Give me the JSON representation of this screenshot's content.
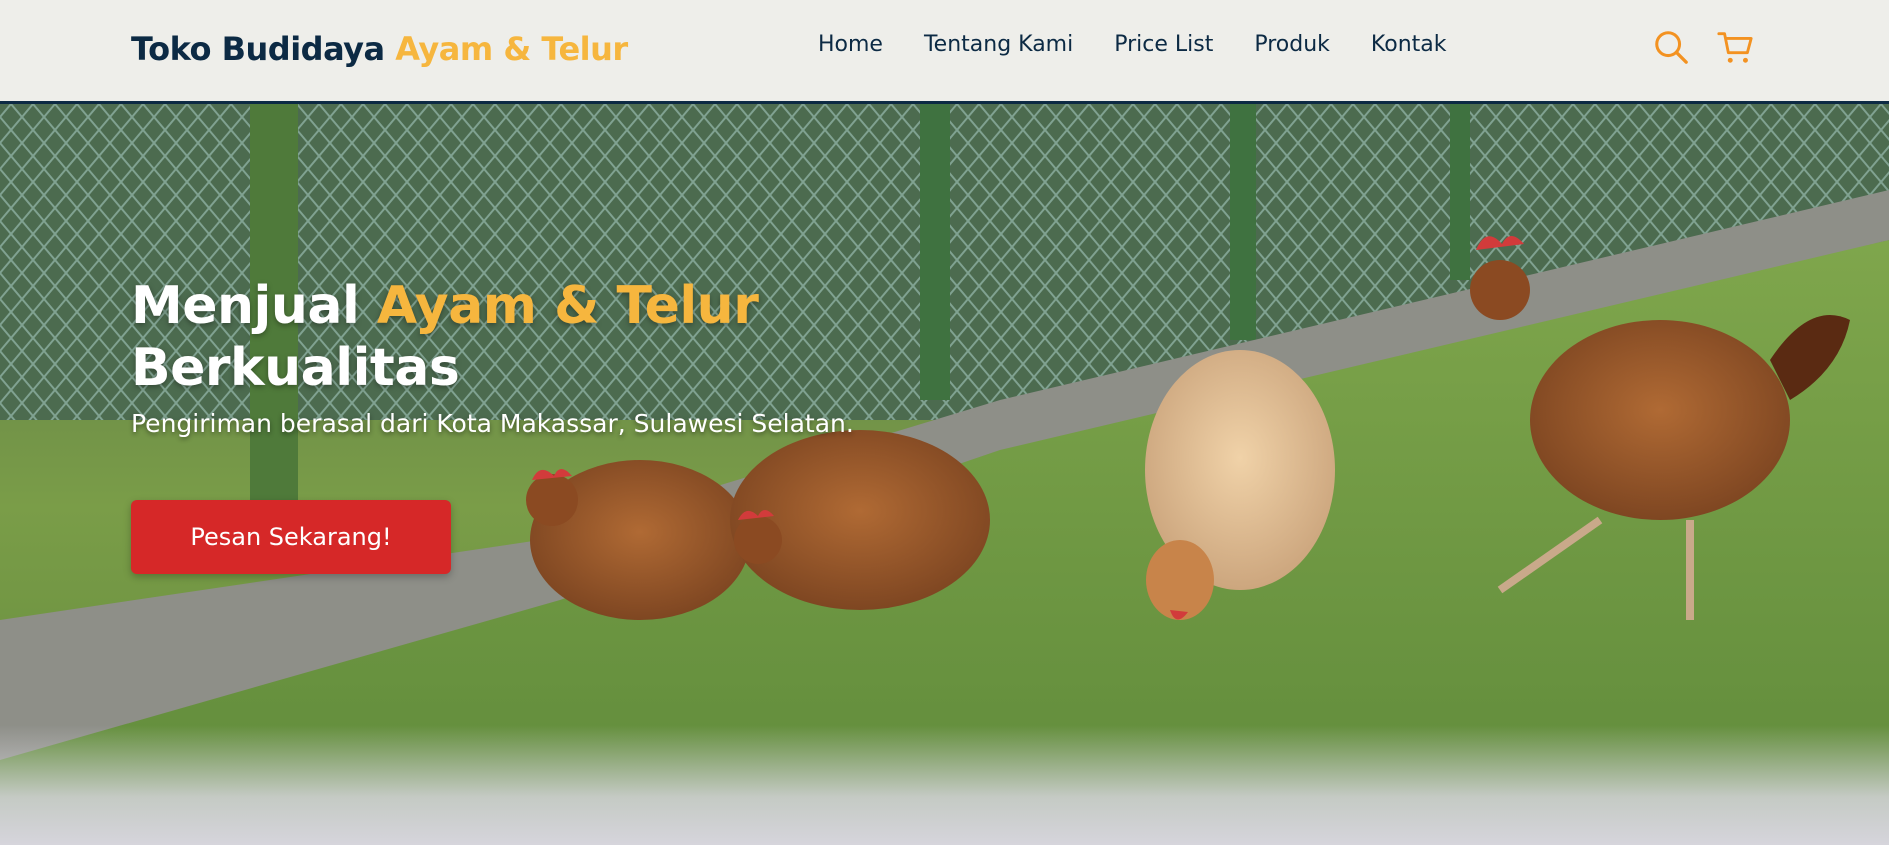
{
  "brand": {
    "name_primary": "Toko Budidaya",
    "name_accent": "Ayam & Telur"
  },
  "nav": {
    "links": [
      "Home",
      "Tentang Kami",
      "Price List",
      "Produk",
      "Kontak"
    ],
    "icons": [
      "search-icon",
      "shopping-cart-icon"
    ]
  },
  "hero": {
    "title_primary": "Menjual",
    "title_accent": "Ayam & Telur",
    "title_line2": "Berkualitas",
    "subtitle": "Pengiriman berasal dari Kota Makassar, Sulawesi Selatan.",
    "cta_label": "Pesan Sekarang!"
  },
  "colors": {
    "brand_dark": "#0c2a44",
    "accent_yellow": "#f6b63e",
    "icon_orange": "#f39221",
    "cta_red": "#d62828",
    "navbar_bg": "#eeeeea"
  }
}
